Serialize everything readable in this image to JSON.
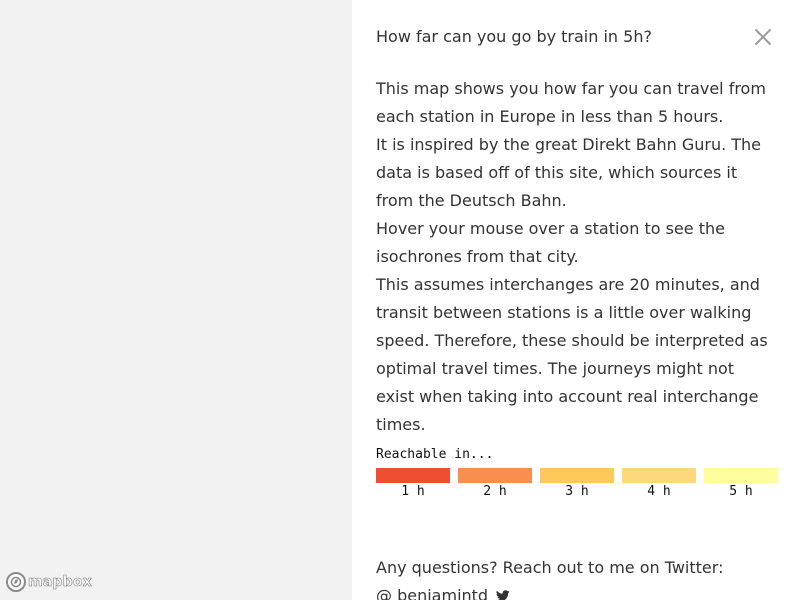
{
  "map": {
    "attribution_logo": "mapbox",
    "background_color": "#f2f2f2"
  },
  "panel": {
    "title": "How far can you go by train in 5h?",
    "close_icon": "close-icon",
    "paragraphs": [
      "This map shows you how far you can travel from each station in Europe in less than 5 hours.",
      "It is inspired by the great Direkt Bahn Guru. The data is based off of this site, which sources it from the Deutsch Bahn.",
      "Hover your mouse over a station to see the isochrones from that city.",
      "This assumes interchanges are 20 minutes, and transit between stations is a little over walking speed. Therefore, these should be interpreted as optimal travel times. The journeys might not exist when taking into account real interchange times."
    ],
    "legend": {
      "title": "Reachable in...",
      "items": [
        {
          "label": "1 h",
          "color": "#f04e33"
        },
        {
          "label": "2 h",
          "color": "#f88f4f"
        },
        {
          "label": "3 h",
          "color": "#fec95a"
        },
        {
          "label": "4 h",
          "color": "#fed87a"
        },
        {
          "label": "5 h",
          "color": "#fefe9e"
        }
      ]
    },
    "contact": {
      "line1": "Any questions? Reach out to me on Twitter:",
      "handle": "@ benjamintd",
      "twitter_icon": "twitter-icon"
    }
  }
}
